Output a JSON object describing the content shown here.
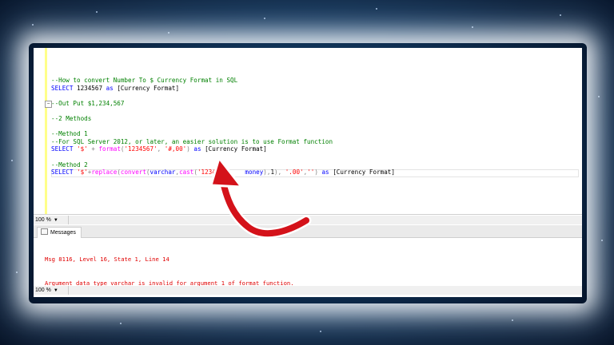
{
  "editor": {
    "lines": [
      {
        "parts": [
          {
            "t": "--How to convert Number To $ Currency Format in SQL",
            "c": "cm"
          }
        ]
      },
      {
        "parts": [
          {
            "t": "SELECT ",
            "c": "kw"
          },
          {
            "t": "1234567 ",
            "c": ""
          },
          {
            "t": "as ",
            "c": "kw"
          },
          {
            "t": "[Currency Format]",
            "c": ""
          }
        ]
      },
      {
        "parts": [
          {
            "t": "",
            "c": ""
          }
        ]
      },
      {
        "parts": [
          {
            "t": "--Out Put $1,234,567",
            "c": "cm"
          }
        ]
      },
      {
        "parts": [
          {
            "t": "",
            "c": ""
          }
        ]
      },
      {
        "parts": [
          {
            "t": "--2 Methods",
            "c": "cm"
          }
        ]
      },
      {
        "parts": [
          {
            "t": "",
            "c": ""
          }
        ]
      },
      {
        "parts": [
          {
            "t": "--Method 1",
            "c": "cm"
          }
        ]
      },
      {
        "parts": [
          {
            "t": "--For SQL Server 2012, or later, an easier solution is to use Format function",
            "c": "cm"
          }
        ]
      },
      {
        "parts": [
          {
            "t": "SELECT ",
            "c": "kw"
          },
          {
            "t": "'$' ",
            "c": "str"
          },
          {
            "t": "+ ",
            "c": "gr"
          },
          {
            "t": "format",
            "c": "fn"
          },
          {
            "t": "(",
            "c": "gr"
          },
          {
            "t": "'1234567'",
            "c": "str"
          },
          {
            "t": ", ",
            "c": "gr"
          },
          {
            "t": "'#,00'",
            "c": "str"
          },
          {
            "t": ") ",
            "c": "gr"
          },
          {
            "t": "as ",
            "c": "kw"
          },
          {
            "t": "[Currency Format]",
            "c": ""
          }
        ]
      },
      {
        "parts": [
          {
            "t": "",
            "c": ""
          }
        ]
      },
      {
        "parts": [
          {
            "t": "--Method 2",
            "c": "cm"
          }
        ]
      },
      {
        "parts": [
          {
            "t": "SELECT ",
            "c": "kw"
          },
          {
            "t": "'$'",
            "c": "str"
          },
          {
            "t": "+",
            "c": "gr"
          },
          {
            "t": "replace",
            "c": "fn"
          },
          {
            "t": "(",
            "c": "gr"
          },
          {
            "t": "convert",
            "c": "fn"
          },
          {
            "t": "(",
            "c": "gr"
          },
          {
            "t": "varchar",
            "c": "kw"
          },
          {
            "t": ",",
            "c": "gr"
          },
          {
            "t": "cast",
            "c": "fn"
          },
          {
            "t": "(",
            "c": "gr"
          },
          {
            "t": "'123456",
            "c": "str"
          },
          {
            "t": "      ",
            "c": ""
          },
          {
            "t": "money",
            "c": "kw"
          },
          {
            "t": "),",
            "c": "gr"
          },
          {
            "t": "1",
            "c": ""
          },
          {
            "t": "), ",
            "c": "gr"
          },
          {
            "t": "'.00'",
            "c": "str"
          },
          {
            "t": ",",
            "c": "gr"
          },
          {
            "t": "''",
            "c": "str"
          },
          {
            "t": ") ",
            "c": "gr"
          },
          {
            "t": "as ",
            "c": "kw"
          },
          {
            "t": "[Currency Format]",
            "c": ""
          }
        ]
      }
    ]
  },
  "zoom_top": "100 %",
  "zoom_bottom": "100 %",
  "results_tab": "Messages",
  "messages": [
    "Msg 8116, Level 16, State 1, Line 14",
    "Argument data type varchar is invalid for argument 1 of format function."
  ],
  "colors": {
    "comment": "#008000",
    "keyword": "#0000ff",
    "string": "#ff0000",
    "function": "#ff00ff",
    "error": "#e00000",
    "arrow": "#d4121a"
  },
  "icons": [
    "collapse-minus-icon",
    "messages-tab-icon",
    "dropdown-icon",
    "red-curved-arrow"
  ]
}
